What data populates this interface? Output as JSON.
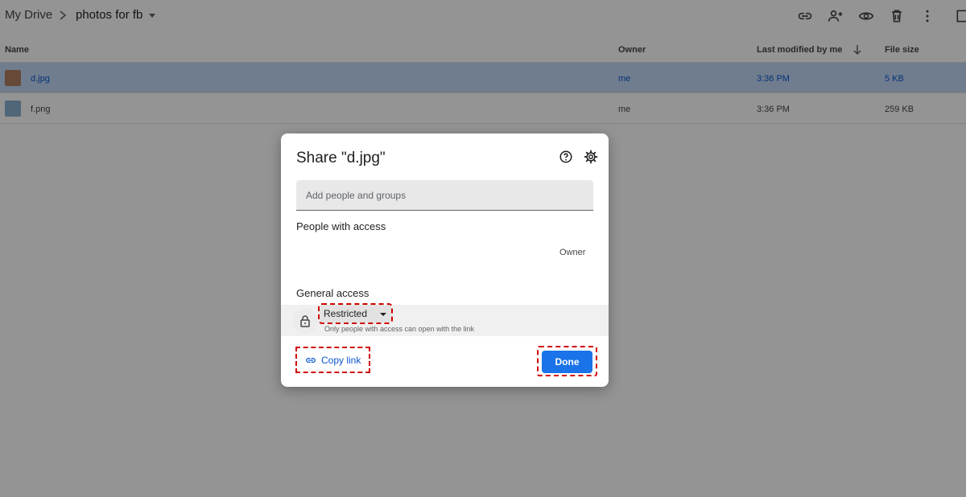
{
  "breadcrumb": {
    "root": "My Drive",
    "folder": "photos for fb"
  },
  "toolbar": {
    "icons": [
      "link-icon",
      "add-person-icon",
      "eye-icon",
      "trash-icon",
      "more-vert-icon"
    ]
  },
  "table": {
    "headers": {
      "name": "Name",
      "owner": "Owner",
      "modified": "Last modified by me",
      "size": "File size"
    },
    "rows": [
      {
        "name": "d.jpg",
        "owner": "me",
        "modified": "3:36 PM",
        "size": "5 KB",
        "selected": true
      },
      {
        "name": "f.png",
        "owner": "me",
        "modified": "3:36 PM",
        "size": "259 KB",
        "selected": false
      }
    ]
  },
  "dialog": {
    "title": "Share \"d.jpg\"",
    "add_placeholder": "Add people and groups",
    "people_label": "People with access",
    "owner_role": "Owner",
    "general_label": "General access",
    "access_level": "Restricted",
    "access_desc": "Only people with access can open with the link",
    "copy_link": "Copy link",
    "done": "Done"
  },
  "colors": {
    "accent": "#1a73e8",
    "selected_row": "#c2d7f5",
    "highlight": "#d00000"
  }
}
